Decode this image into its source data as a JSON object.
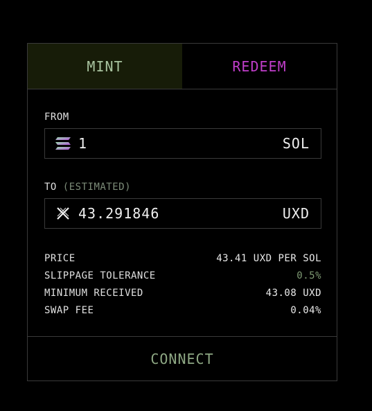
{
  "tabs": {
    "mint_label": "MINT",
    "redeem_label": "REDEEM",
    "active": "MINT"
  },
  "from": {
    "label": "FROM",
    "amount": "1",
    "currency": "SOL",
    "icon": "solana-icon"
  },
  "to": {
    "label": "TO",
    "label_suffix": "(ESTIMATED)",
    "amount": "43.291846",
    "currency": "UXD",
    "icon": "uxd-icon"
  },
  "details": {
    "price_label": "PRICE",
    "price_value": "43.41 UXD PER SOL",
    "slippage_label": "SLIPPAGE TOLERANCE",
    "slippage_value": "0.5%",
    "minimum_label": "MINIMUM RECEIVED",
    "minimum_value": "43.08 UXD",
    "fee_label": "SWAP FEE",
    "fee_value": "0.04%"
  },
  "connect_label": "CONNECT",
  "colors": {
    "mint_bg": "#171c08",
    "mint_text": "#a9c4a0",
    "redeem_text": "#c13ecb",
    "accent_green": "#7e9a73",
    "border": "#3a3a3a"
  }
}
